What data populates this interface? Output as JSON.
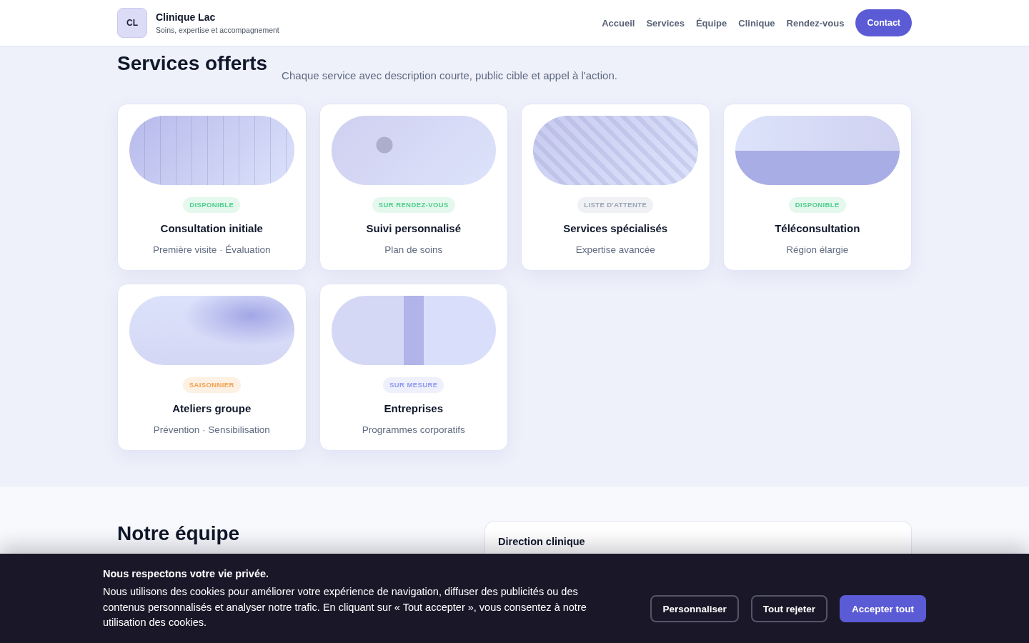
{
  "header": {
    "logo": "CL",
    "brand": "Clinique Lac",
    "tagline": "Soins, expertise et accompagnement",
    "nav": [
      {
        "label": "Accueil"
      },
      {
        "label": "Services"
      },
      {
        "label": "Équipe"
      },
      {
        "label": "Clinique"
      },
      {
        "label": "Rendez-vous"
      }
    ],
    "cta": "Contact"
  },
  "services": {
    "title": "Services offerts",
    "subtitle": "Chaque service avec description courte, public cible et appel à l'action.",
    "cards": [
      {
        "kind": "lines",
        "badge": {
          "label": "DISPONIBLE",
          "color": "#4fcf8c"
        },
        "title": "Consultation initiale",
        "description": "Première visite · Évaluation"
      },
      {
        "kind": "dot",
        "badge": {
          "label": "SUR RENDEZ-VOUS",
          "color": "#4fcf8c"
        },
        "title": "Suivi personnalisé",
        "description": "Plan de soins"
      },
      {
        "kind": "hatched",
        "badge": {
          "label": "LISTE D'ATTENTE",
          "color": "#9aa4b6"
        },
        "title": "Services spécialisés",
        "description": "Expertise avancée"
      },
      {
        "kind": "split",
        "badge": {
          "label": "DISPONIBLE",
          "color": "#4fcf8c"
        },
        "title": "Téléconsultation",
        "description": "Région élargie"
      },
      {
        "kind": "glow",
        "badge": {
          "label": "SAISONNIER",
          "color": "#f0a04e"
        },
        "title": "Ateliers groupe",
        "description": "Prévention · Sensibilisation"
      },
      {
        "kind": "band",
        "badge": {
          "label": "SUR MESURE",
          "color": "#8f9aec"
        },
        "title": "Entreprises",
        "description": "Programmes corporatifs"
      }
    ]
  },
  "team": {
    "title": "Notre équipe",
    "card_title": "Direction clinique"
  },
  "cookie_banner": {
    "title": "Nous respectons votre vie privée.",
    "text": "Nous utilisons des cookies pour améliorer votre expérience de navigation, diffuser des publicités ou des contenus personnalisés et analyser notre trafic. En cliquant sur « Tout accepter », vous consentez à notre utilisation des cookies.",
    "buttons": [
      {
        "label": "Personnaliser",
        "kind": "outline"
      },
      {
        "label": "Tout rejeter",
        "kind": "outline"
      },
      {
        "label": "Accepter tout",
        "kind": "primary"
      }
    ]
  }
}
